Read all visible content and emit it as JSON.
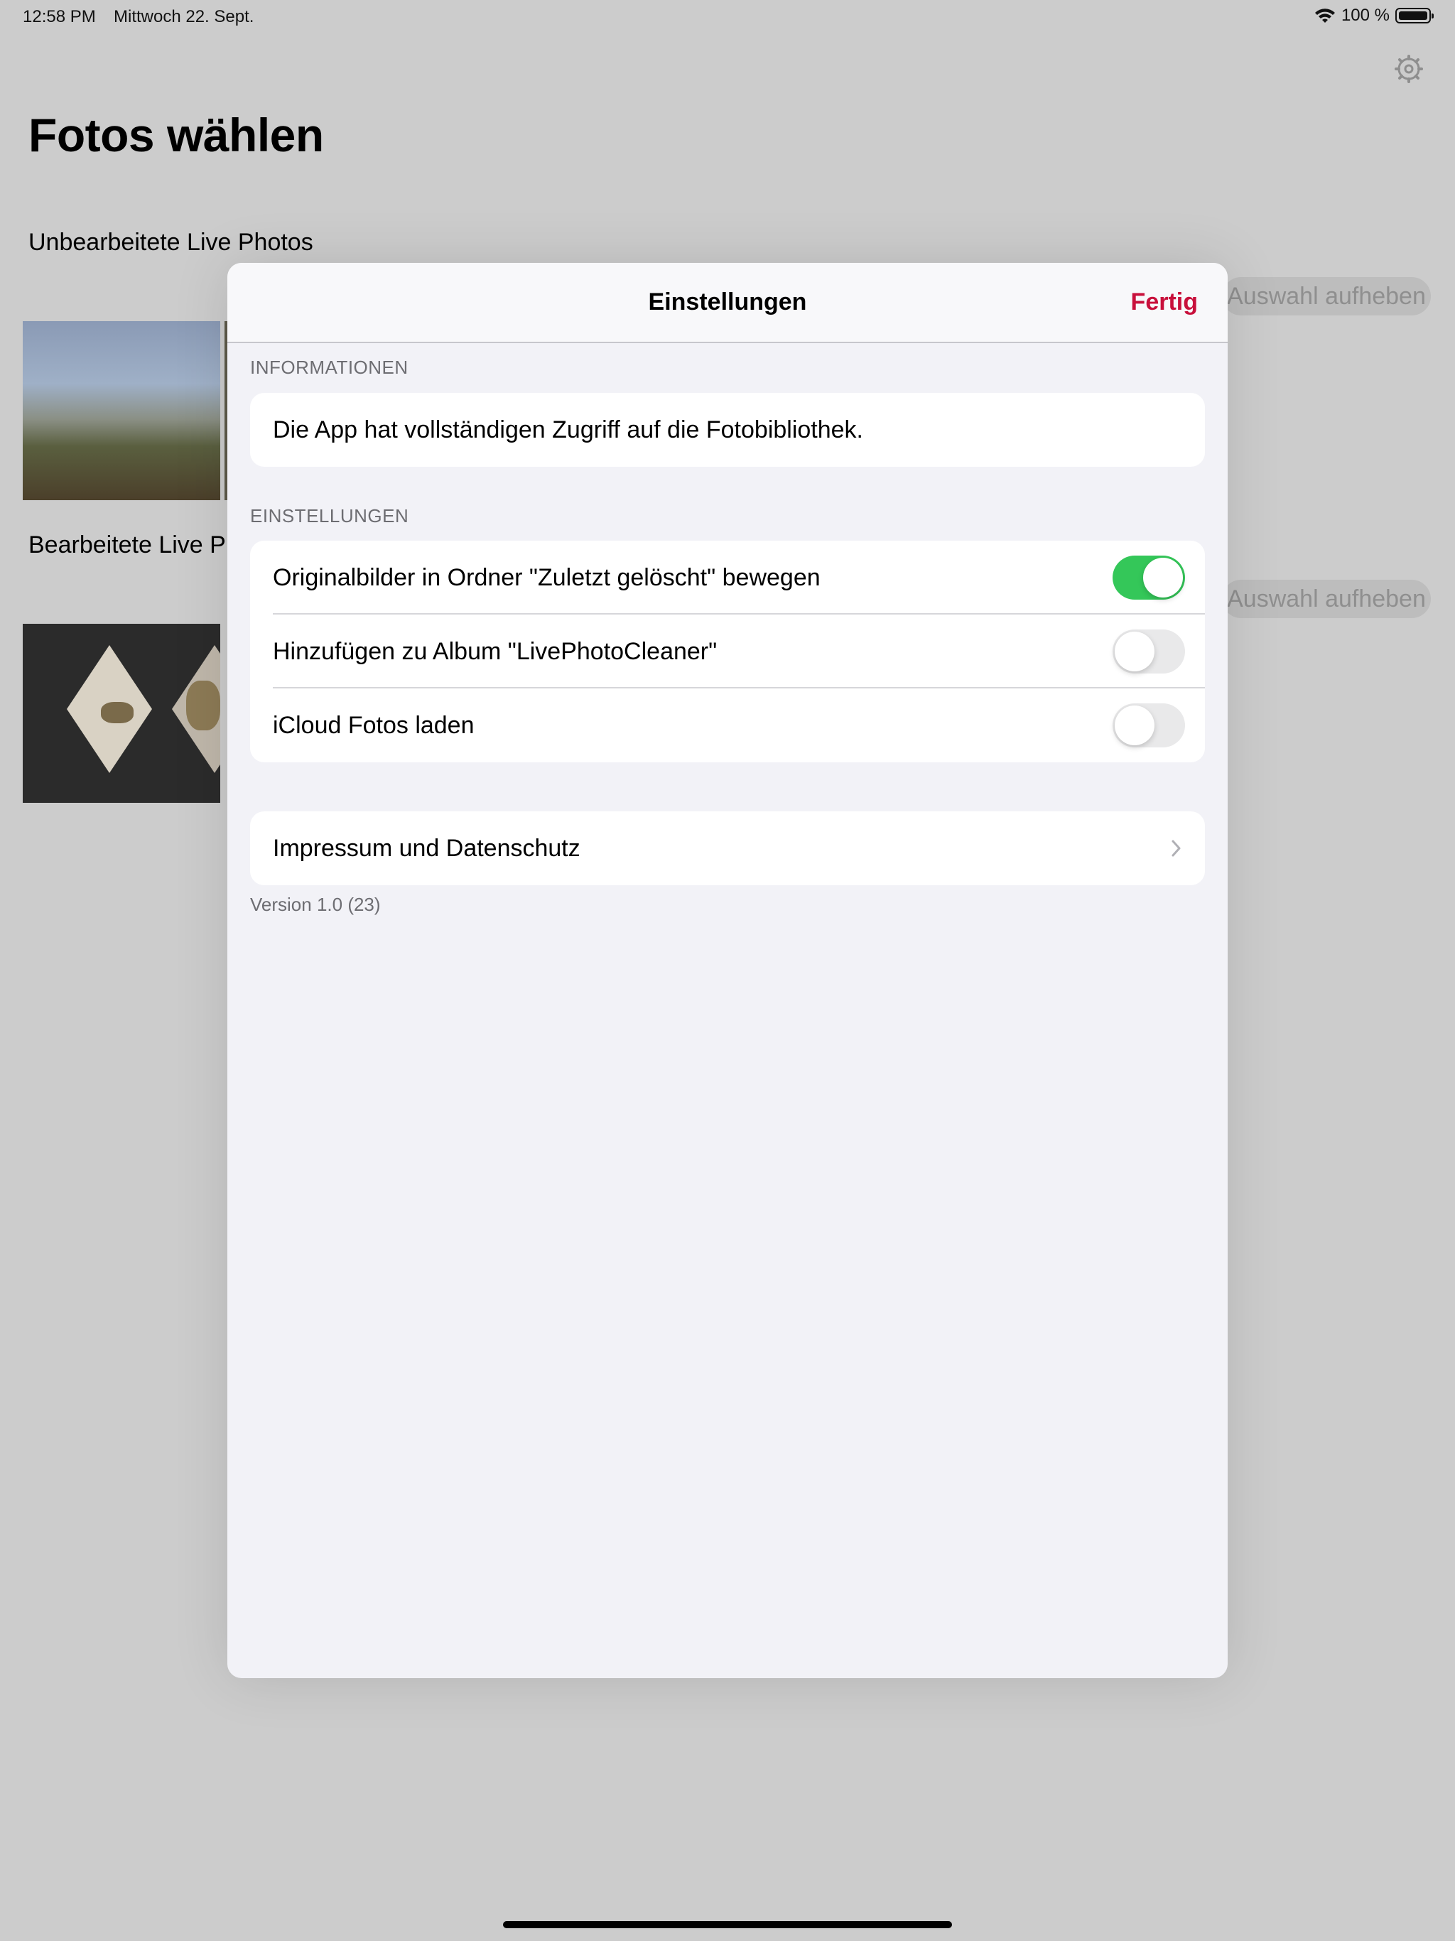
{
  "status_bar": {
    "time": "12:58 PM",
    "date": "Mittwoch 22. Sept.",
    "battery": "100 %"
  },
  "main": {
    "title": "Fotos wählen",
    "sections": [
      {
        "label": "Unbearbeitete Live Photos",
        "action": "Auswahl aufheben"
      },
      {
        "label": "Bearbeitete Live Photos",
        "action": "Auswahl aufheben"
      }
    ]
  },
  "sheet": {
    "title": "Einstellungen",
    "done_label": "Fertig",
    "info_header": "INFORMATIONEN",
    "info_text": "Die App hat vollständigen Zugriff auf die Fotobibliothek.",
    "settings_header": "EINSTELLUNGEN",
    "settings": [
      {
        "label": "Originalbilder in Ordner \"Zuletzt gelöscht\" bewegen",
        "on": true
      },
      {
        "label": "Hinzufügen zu Album \"LivePhotoCleaner\"",
        "on": false
      },
      {
        "label": "iCloud Fotos laden",
        "on": false
      }
    ],
    "legal_label": "Impressum und Datenschutz",
    "version": "Version 1.0 (23)"
  },
  "colors": {
    "accent": "#c8103b",
    "toggle_on": "#34c759",
    "toggle_off": "#e9e9ea"
  }
}
